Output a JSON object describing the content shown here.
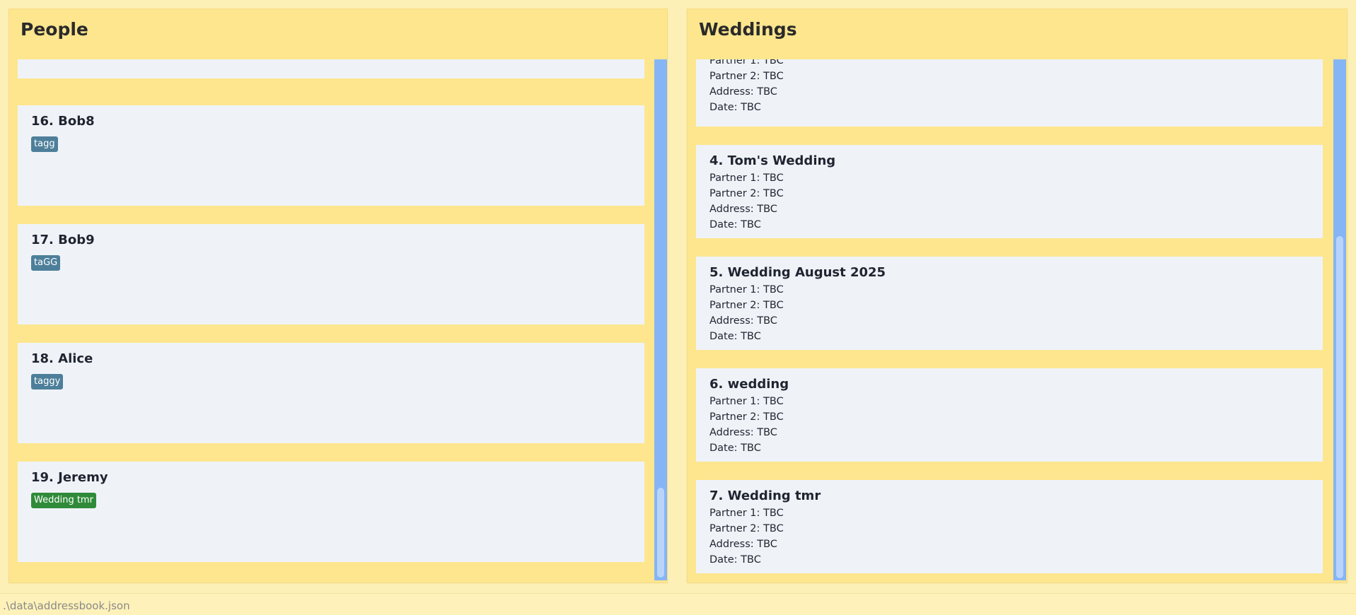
{
  "people_panel": {
    "title": "People",
    "persons": [
      {
        "index_name": "",
        "tags": []
      },
      {
        "index_name": "16. Bob8",
        "tags": [
          {
            "label": "tagg",
            "color": "#4d7f9a"
          }
        ]
      },
      {
        "index_name": "17. Bob9",
        "tags": [
          {
            "label": "taGG",
            "color": "#4d7f9a"
          }
        ]
      },
      {
        "index_name": "18. Alice",
        "tags": [
          {
            "label": "taggy",
            "color": "#4d7f9a"
          }
        ]
      },
      {
        "index_name": "19. Jeremy",
        "tags": [
          {
            "label": "Wedding tmr",
            "color": "#2f8b3a"
          }
        ]
      }
    ]
  },
  "weddings_panel": {
    "title": "Weddings",
    "weddings": [
      {
        "index_name": "",
        "partner1": "Partner 1: TBC",
        "partner2": "Partner 2: TBC",
        "address": "Address: TBC",
        "date": "Date: TBC"
      },
      {
        "index_name": "4. Tom's Wedding",
        "partner1": "Partner 1: TBC",
        "partner2": "Partner 2: TBC",
        "address": "Address: TBC",
        "date": "Date: TBC"
      },
      {
        "index_name": "5. Wedding August 2025",
        "partner1": "Partner 1: TBC",
        "partner2": "Partner 2: TBC",
        "address": "Address: TBC",
        "date": "Date: TBC"
      },
      {
        "index_name": "6. wedding",
        "partner1": "Partner 1: TBC",
        "partner2": "Partner 2: TBC",
        "address": "Address: TBC",
        "date": "Date: TBC"
      },
      {
        "index_name": "7. Wedding tmr",
        "partner1": "Partner 1: TBC",
        "partner2": "Partner 2: TBC",
        "address": "Address: TBC",
        "date": "Date: TBC"
      }
    ]
  },
  "status_bar": {
    "file_path": ".\\data\\addressbook.json"
  },
  "colors": {
    "background": "#fdf0b6",
    "panel": "#fde68e",
    "card": "#eff3f8",
    "scrollbar_track": "#86b5f5",
    "tag_default": "#4d7f9a",
    "tag_wedding": "#2f8b3a"
  }
}
